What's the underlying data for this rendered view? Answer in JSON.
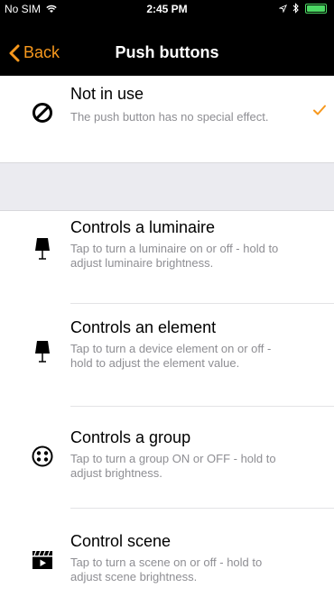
{
  "status_bar": {
    "carrier": "No SIM",
    "time": "2:45 PM"
  },
  "nav": {
    "back_label": "Back",
    "title": "Push buttons"
  },
  "options": [
    {
      "title": "Not in use",
      "description": "The push button has no special effect.",
      "icon": "no-sign-icon",
      "selected": true
    },
    {
      "title": "Controls a luminaire",
      "description": "Tap to turn a luminaire on or off - hold to adjust luminaire brightness.",
      "icon": "lamp-icon",
      "selected": false
    },
    {
      "title": "Controls an element",
      "description": "Tap to turn a device element on or off - hold to adjust the element value.",
      "icon": "lamp-icon",
      "selected": false
    },
    {
      "title": "Controls a group",
      "description": "Tap to turn a group ON or OFF - hold to adjust brightness.",
      "icon": "group-icon",
      "selected": false
    },
    {
      "title": "Control scene",
      "description": "Tap to turn a scene on or off - hold to adjust scene brightness.",
      "icon": "clapperboard-icon",
      "selected": false
    }
  ],
  "colors": {
    "accent": "#f7981d",
    "bar_background": "#000000",
    "section_gap": "#ebebf0",
    "description_text": "#8e8e93"
  }
}
